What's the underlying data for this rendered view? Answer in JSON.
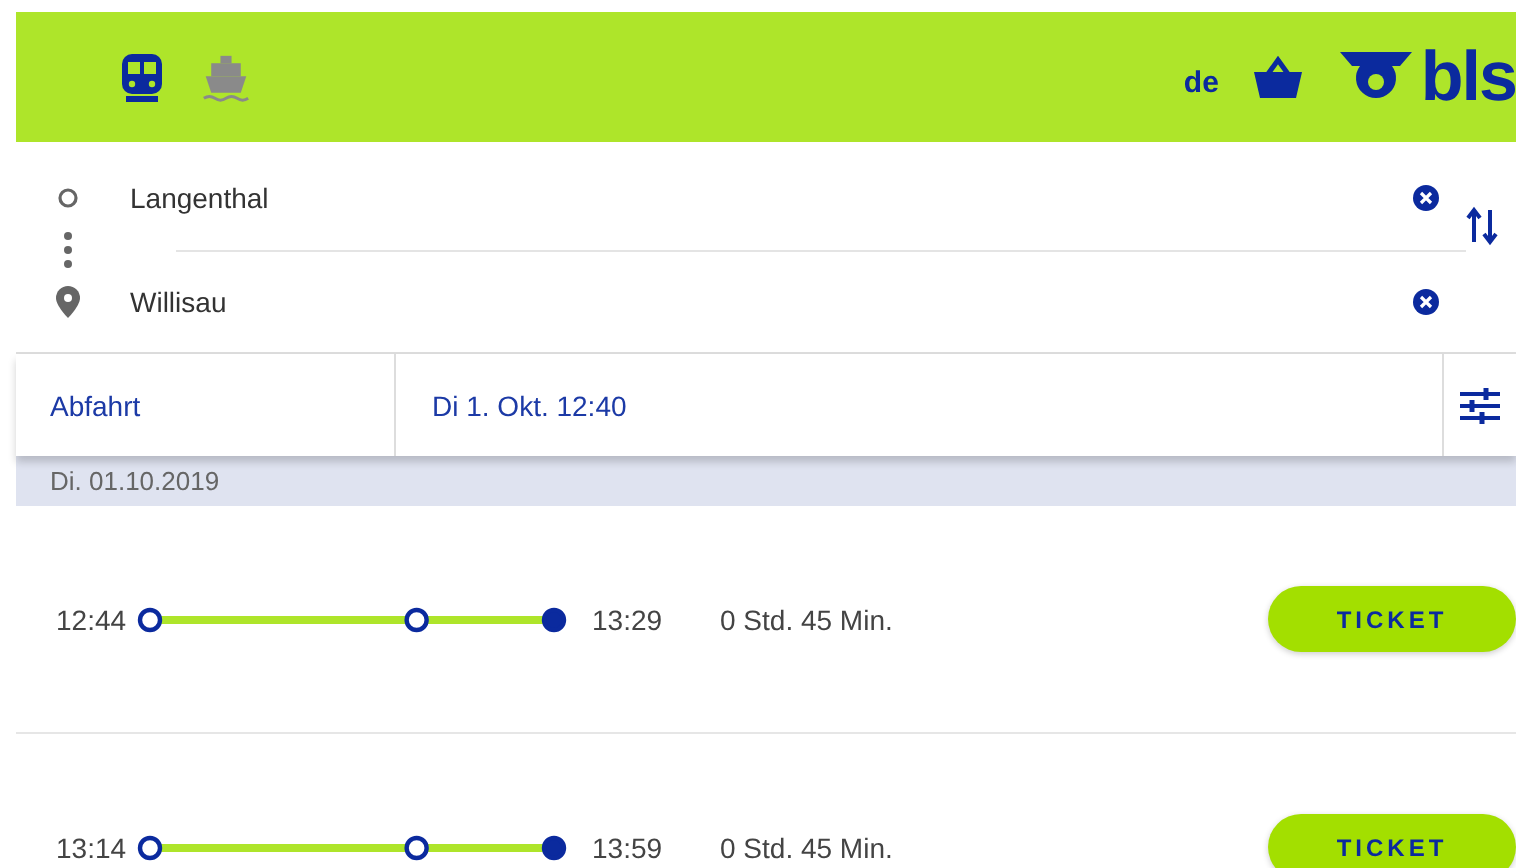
{
  "header": {
    "modes": [
      {
        "kind": "train",
        "selected": true
      },
      {
        "kind": "boat",
        "selected": false
      }
    ],
    "language": "de",
    "logo": "bls"
  },
  "route": {
    "from": "Langenthal",
    "to": "Willisau"
  },
  "query": {
    "mode": "Abfahrt",
    "datetime": "Di 1. Okt. 12:40"
  },
  "date_band": "Di. 01.10.2019",
  "connections": [
    {
      "departure": "12:44",
      "arrival": "13:29",
      "duration": "0 Std. 45 Min.",
      "stops": [
        {
          "filled": false
        },
        {
          "filled": false
        },
        {
          "filled": true
        }
      ],
      "button": "TICKET"
    },
    {
      "departure": "13:14",
      "arrival": "13:59",
      "duration": "0 Std. 45 Min.",
      "stops": [
        {
          "filled": false
        },
        {
          "filled": false
        },
        {
          "filled": true
        }
      ],
      "button": "TICKET"
    }
  ]
}
